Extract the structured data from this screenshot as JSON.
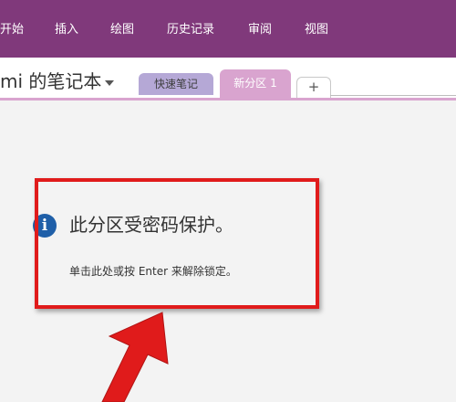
{
  "menu": {
    "items": [
      "开始",
      "插入",
      "绘图",
      "历史记录",
      "审阅",
      "视图"
    ]
  },
  "notebook": {
    "title": "mi 的笔记本"
  },
  "tabs": {
    "quick_notes": "快速笔记",
    "new_section": "新分区 1",
    "add": "+"
  },
  "lock_message": {
    "heading": "此分区受密码保护。",
    "hint": "单击此处或按 Enter 来解除锁定。",
    "icon": "info-icon"
  },
  "colors": {
    "ribbon": "#80397b",
    "annotation": "#e01b1b",
    "tab_new_section": "#d9a4cf",
    "tab_quick_notes": "#b5a8d6"
  }
}
